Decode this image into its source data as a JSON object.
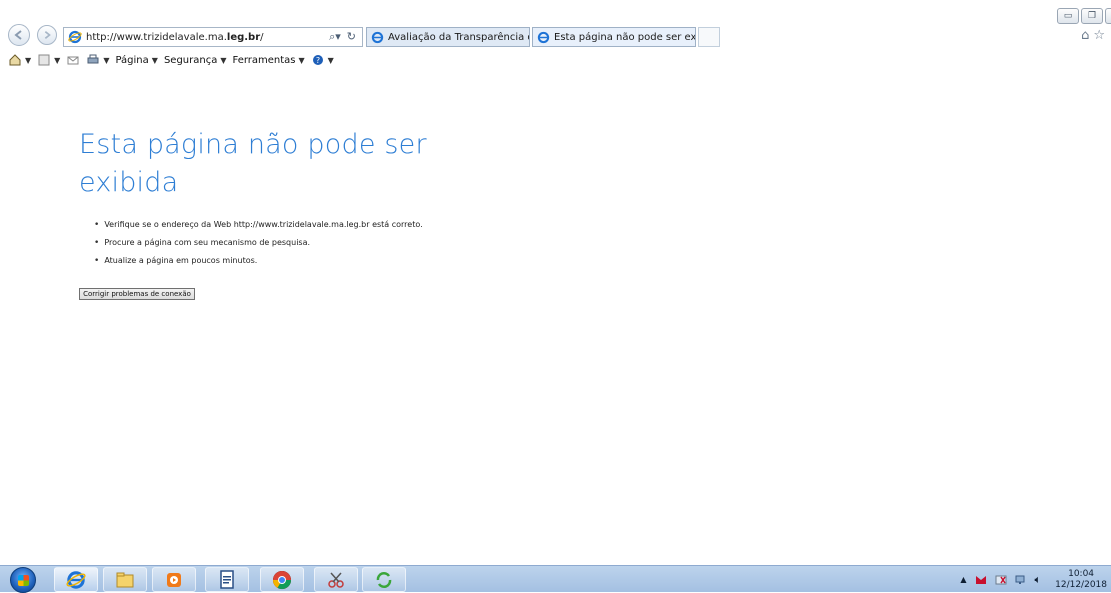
{
  "browser": {
    "address": {
      "prefix": "http://www.trizidelavale.ma.",
      "bold": "leg.br",
      "suffix": "/"
    },
    "tabs": [
      {
        "label": "Avaliação da Transparência do...",
        "active": false
      },
      {
        "label": "Esta página não pode ser ex...",
        "active": true
      }
    ],
    "command_bar": {
      "page_label": "Página",
      "security_label": "Segurança",
      "tools_label": "Ferramentas"
    }
  },
  "page": {
    "title": "Esta página não pode ser exibida",
    "bullets": [
      "Verifique se o endereço da Web http://www.trizidelavale.ma.leg.br está correto.",
      "Procure a página com seu mecanismo de pesquisa.",
      "Atualize a página em poucos minutos."
    ],
    "fix_button": "Corrigir problemas de conexão"
  },
  "taskbar": {
    "clock_time": "10:04",
    "clock_date": "12/12/2018"
  },
  "colors": {
    "title_blue": "#2e7ed4",
    "taskbar": "#b0c9e8"
  }
}
